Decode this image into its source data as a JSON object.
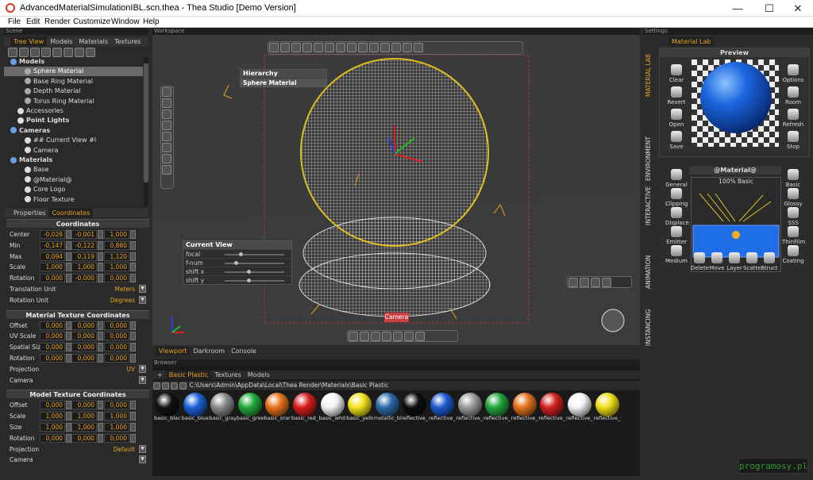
{
  "window": {
    "title": "AdvancedMaterialSimulationIBL.scn.thea - Thea Studio [Demo Version]",
    "minimize": "—",
    "maximize": "☐",
    "close": "✕"
  },
  "menu": [
    "File",
    "Edit",
    "Render",
    "Customize",
    "Window",
    "Help"
  ],
  "scene": {
    "header": "Scene",
    "tabs": [
      "Tree View",
      "Models",
      "Materials",
      "Textures"
    ],
    "tree": [
      {
        "label": "Models",
        "indent": 0,
        "bold": true
      },
      {
        "label": "Sphere Material",
        "indent": 2,
        "selected": true
      },
      {
        "label": "Base Ring Material",
        "indent": 2
      },
      {
        "label": "Depth Material",
        "indent": 2
      },
      {
        "label": "Torus Ring Material",
        "indent": 2
      },
      {
        "label": "Accessories",
        "indent": 1
      },
      {
        "label": "Point Lights",
        "indent": 1,
        "bold": true
      },
      {
        "label": "Cameras",
        "indent": 0,
        "bold": true
      },
      {
        "label": "## Current View #I",
        "indent": 2
      },
      {
        "label": "Camera",
        "indent": 2
      },
      {
        "label": "Materials",
        "indent": 0,
        "bold": true
      },
      {
        "label": "Base",
        "indent": 2
      },
      {
        "label": "@Material@",
        "indent": 2
      },
      {
        "label": "Core Logo",
        "indent": 2
      },
      {
        "label": "Floor Texture",
        "indent": 2
      }
    ],
    "prop_tabs": [
      "Properties",
      "Coordinates"
    ],
    "coords": {
      "title": "Coordinates",
      "rows": [
        {
          "label": "Center",
          "v": [
            "-0,026",
            "-0,001",
            "1,000"
          ]
        },
        {
          "label": "Min",
          "v": [
            "-0,147",
            "-0,122",
            "0,880"
          ]
        },
        {
          "label": "Max",
          "v": [
            "0,094",
            "0,119",
            "1,120"
          ]
        },
        {
          "label": "Scale",
          "v": [
            "1,000",
            "1,000",
            "1,000"
          ]
        },
        {
          "label": "Rotation",
          "v": [
            "0,000",
            "-0,000",
            "0,000"
          ]
        }
      ],
      "translation_unit_label": "Translation Unit",
      "translation_unit": "Meters",
      "rotation_unit_label": "Rotation Unit",
      "rotation_unit": "Degrees"
    },
    "material_tex": {
      "title": "Material Texture Coordinates",
      "rows": [
        {
          "label": "Offset",
          "v": [
            "0,000",
            "0,000",
            "0,000"
          ]
        },
        {
          "label": "UV Scale",
          "v": [
            "0,000",
            "0,000",
            "0,000"
          ]
        },
        {
          "label": "Spatial Size",
          "v": [
            "0,000",
            "0,000",
            "0,000"
          ]
        },
        {
          "label": "Rotation",
          "v": [
            "0,000",
            "0,000",
            "0,000"
          ]
        }
      ],
      "projection_label": "Projection",
      "projection": "UV",
      "camera_label": "Camera"
    },
    "model_tex": {
      "title": "Model Texture Coordinates",
      "rows": [
        {
          "label": "Offset",
          "v": [
            "0,000",
            "0,000",
            "0,000"
          ]
        },
        {
          "label": "Scale",
          "v": [
            "1,000",
            "1,000",
            "1,000"
          ]
        },
        {
          "label": "Size",
          "v": [
            "1,000",
            "1,000",
            "1,000"
          ]
        },
        {
          "label": "Rotation",
          "v": [
            "0,000",
            "0,000",
            "0,000"
          ]
        }
      ],
      "projection_label": "Projection",
      "projection": "Default",
      "camera_label": "Camera"
    }
  },
  "viewport": {
    "header": "Workspace",
    "hierarchy_title": "Hierarchy",
    "hierarchy_item": "Sphere Material",
    "current_view_title": "Current View",
    "current_view_rows": [
      "focal",
      "f-num",
      "shift x",
      "shift y"
    ],
    "camera_label": "Camera",
    "tabs": [
      "Viewport",
      "Darkroom",
      "Console"
    ]
  },
  "browser": {
    "header": "Browser",
    "tabs": [
      "Basic Plastic",
      "Textures",
      "Models"
    ],
    "path": "C:\\Users\\Admin\\AppData\\Local\\Thea Render\\Materials\\Basic Plastic",
    "materials": [
      {
        "name": "basic_black",
        "color": "#111111"
      },
      {
        "name": "basic_blue",
        "color": "#1c62d6"
      },
      {
        "name": "basic_gray",
        "color": "#8a8a8a"
      },
      {
        "name": "basic_green",
        "color": "#1fa83a"
      },
      {
        "name": "basic_orang",
        "color": "#e5711a"
      },
      {
        "name": "basic_red_p",
        "color": "#d81e1e"
      },
      {
        "name": "basic_white",
        "color": "#f2f2f2"
      },
      {
        "name": "basic_yello",
        "color": "#f2e219"
      },
      {
        "name": "metallic_blu",
        "color": "#2a6aa8"
      },
      {
        "name": "reflective_b",
        "color": "#0d0d0d"
      },
      {
        "name": "reflective_b",
        "color": "#1c5ad0"
      },
      {
        "name": "reflective_g",
        "color": "#9a9a9a"
      },
      {
        "name": "reflective_g",
        "color": "#21a63b"
      },
      {
        "name": "reflective_o",
        "color": "#e0701c"
      },
      {
        "name": "reflective_r",
        "color": "#d22020"
      },
      {
        "name": "reflective_v",
        "color": "#f4f4f4"
      },
      {
        "name": "reflective_v",
        "color": "#eedd18"
      }
    ]
  },
  "settings": {
    "header": "Settings",
    "tab": "Material Lab",
    "preview_title": "Preview",
    "left_buttons": [
      "Clear",
      "Revert",
      "Open",
      "Save"
    ],
    "right_buttons": [
      "Options",
      "Room",
      "Refresh",
      "Stop"
    ],
    "material_name": "@Material@",
    "layer_label": "100% Basic",
    "side_left": [
      "General",
      "Clipping",
      "Displace",
      "Emitter",
      "Medium"
    ],
    "side_right": [
      "Basic",
      "Glossy",
      "SSS",
      "ThinFilm",
      "Coating"
    ],
    "bottom": [
      "Delete",
      "Move",
      "Layer",
      "Scatter",
      "Struct"
    ],
    "vtabs": [
      "MATERIAL LAB",
      "ENVIRONMENT",
      "INTERACTIVE",
      "ANIMATION",
      "INSTANCING"
    ]
  },
  "watermark": "programosy.pl"
}
